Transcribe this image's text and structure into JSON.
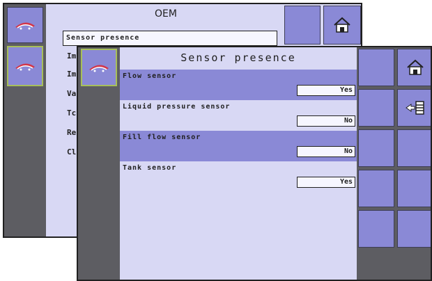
{
  "back_screen": {
    "title": "OEM",
    "selected_field": "Sensor presence",
    "menu_items": [
      "Im",
      "Im",
      "Va",
      "Tc",
      "Re",
      "Cl"
    ]
  },
  "front_screen": {
    "title": "Sensor presence",
    "rows": [
      {
        "label": "Flow sensor",
        "value": "Yes"
      },
      {
        "label": "Liquid pressure sensor",
        "value": "No"
      },
      {
        "label": "Fill flow sensor",
        "value": "No"
      },
      {
        "label": "Tank sensor",
        "value": "Yes"
      }
    ]
  },
  "icons": {
    "sprayer": "sprayer-icon",
    "home": "home-icon",
    "back_list": "back-list-icon"
  },
  "colors": {
    "panel_bg": "#d8d8f4",
    "highlight_row": "#8a89d6",
    "sidebar": "#5d5d62",
    "active_border": "#a7bf5a"
  }
}
